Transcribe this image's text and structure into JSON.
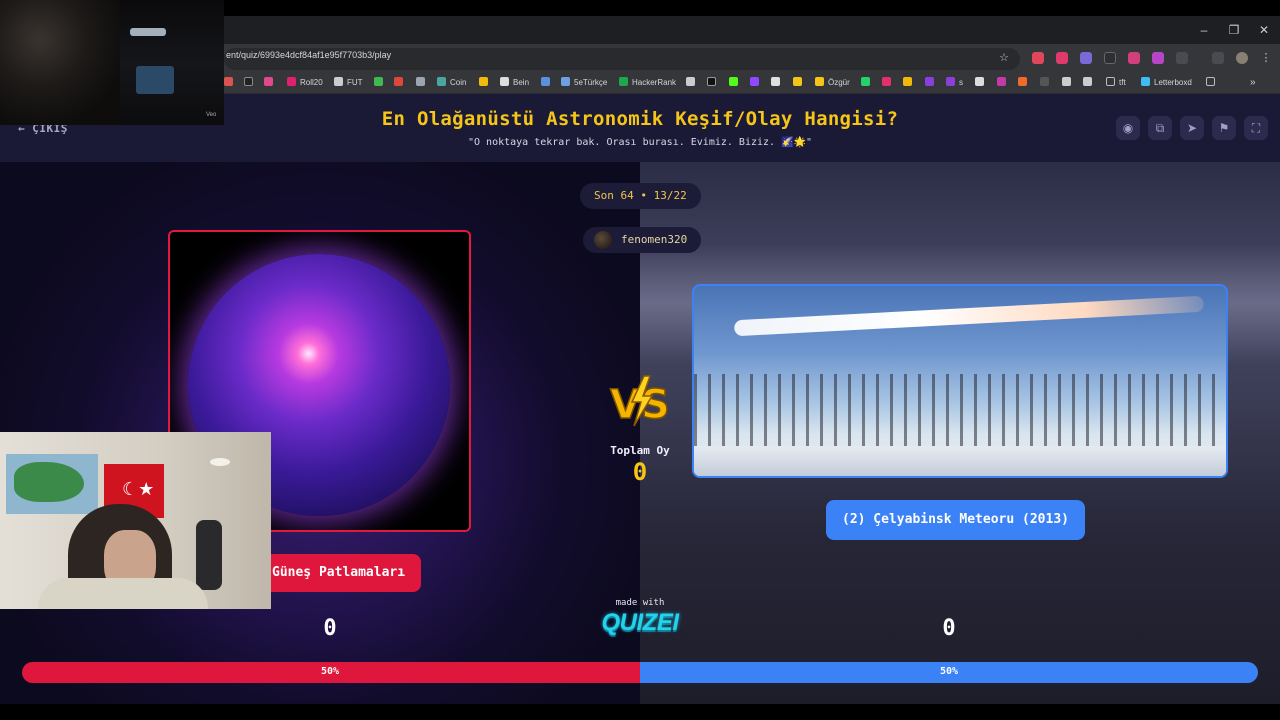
{
  "browser": {
    "url": "ent/quiz/6993e4dcf84af1e95f7703b3/play",
    "window_controls": {
      "minimize": "–",
      "restore": "❐",
      "close": "✕"
    },
    "bookmarks": [
      "Roll20",
      "FUT",
      "Coin",
      "Bein",
      "5eTürkçe",
      "HackerRank",
      "Özgür",
      "s",
      "tft",
      "Letterboxd"
    ]
  },
  "header": {
    "exit_label": "ÇIKIŞ",
    "title": "En Olağanüstü Astronomik Keşif/Olay Hangisi?",
    "subtitle": "\"O noktaya tekrar bak. Orası burası. Evimiz. Biziz. 🌠🌟\""
  },
  "header_icons": [
    "eye-icon",
    "share-icon",
    "send-icon",
    "flag-icon",
    "fullscreen-icon"
  ],
  "round": {
    "label": "Son 64 • 13/22"
  },
  "author": {
    "name": "fenomen320"
  },
  "left_option": {
    "label": "Güneş Patlamaları",
    "votes": "0",
    "percent_label": "50%",
    "percent": 50
  },
  "right_option": {
    "label": "(2) Çelyabinsk Meteoru (2013)",
    "votes": "0",
    "percent_label": "50%",
    "percent": 50
  },
  "center": {
    "total_label": "Toplam Oy",
    "total_value": "0"
  },
  "branding": {
    "made_with": "made with",
    "logo": "QUIZEI"
  },
  "webcam": {
    "driving_tag": "Veo"
  },
  "colors": {
    "title": "#f5c518",
    "left_accent": "#e0173d",
    "right_accent": "#3b82f6",
    "logo": "#22d3ee"
  }
}
